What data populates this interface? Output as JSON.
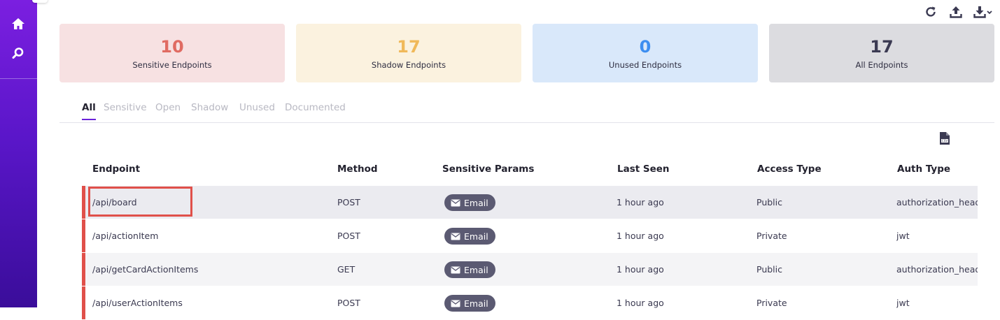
{
  "sidebar": {
    "icons": [
      "home-icon",
      "search-icon"
    ]
  },
  "toolbar": {
    "icons": [
      "refresh-icon",
      "upload-icon",
      "download-icon",
      "chevron-down-icon"
    ]
  },
  "cards": [
    {
      "value": "10",
      "label": "Sensitive Endpoints",
      "bg": "#f7e1e2",
      "color": "#e06b62"
    },
    {
      "value": "17",
      "label": "Shadow Endpoints",
      "bg": "#fbf2df",
      "color": "#f0b95a"
    },
    {
      "value": "0",
      "label": "Unused Endpoints",
      "bg": "#d9e8fa",
      "color": "#3d8ef0"
    },
    {
      "value": "17",
      "label": "All Endpoints",
      "bg": "#dcdce0",
      "color": "#3b3a52"
    }
  ],
  "tabs": [
    "All",
    "Sensitive",
    "Open",
    "Shadow",
    "Unused",
    "Documented"
  ],
  "table": {
    "headers": [
      "Endpoint",
      "Method",
      "Sensitive Params",
      "Last Seen",
      "Access Type",
      "Auth Type"
    ],
    "rows": [
      {
        "endpoint": "/api/board",
        "method": "POST",
        "param": "Email",
        "last_seen": "1 hour ago",
        "access": "Public",
        "auth": "authorization_header"
      },
      {
        "endpoint": "/api/actionItem",
        "method": "POST",
        "param": "Email",
        "last_seen": "1 hour ago",
        "access": "Private",
        "auth": "jwt"
      },
      {
        "endpoint": "/api/getCardActionItems",
        "method": "GET",
        "param": "Email",
        "last_seen": "1 hour ago",
        "access": "Public",
        "auth": "authorization_header"
      },
      {
        "endpoint": "/api/userActionItems",
        "method": "POST",
        "param": "Email",
        "last_seen": "1 hour ago",
        "access": "Private",
        "auth": "jwt"
      }
    ]
  },
  "colors": {
    "accent": "#6a22d9",
    "sensitive_bar": "#e0504a",
    "pill": "#5b5a72"
  }
}
